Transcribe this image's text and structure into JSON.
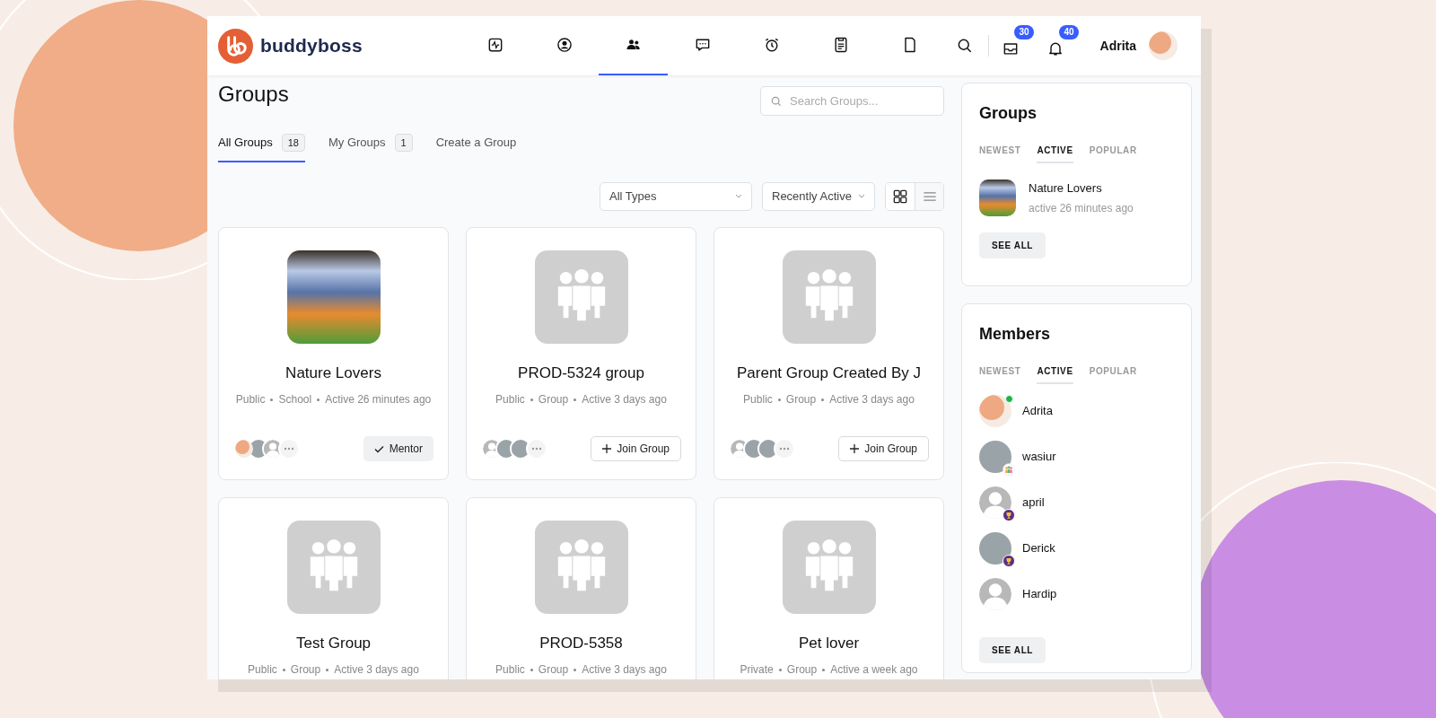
{
  "header": {
    "logo_text": "buddyboss",
    "nav": [
      {
        "kind": "activity",
        "selected": false
      },
      {
        "kind": "profile",
        "selected": false
      },
      {
        "kind": "groups",
        "selected": true
      },
      {
        "kind": "messages",
        "selected": false
      },
      {
        "kind": "alarm",
        "selected": false
      },
      {
        "kind": "document",
        "selected": false
      },
      {
        "kind": "page",
        "selected": false
      }
    ],
    "counters": [
      {
        "kind": "inbox",
        "count": "30"
      },
      {
        "kind": "bell",
        "count": "40"
      }
    ],
    "user": {
      "name": "Adrita"
    }
  },
  "main": {
    "title": "Groups",
    "search": {
      "placeholder": "Search Groups..."
    },
    "tabs": [
      {
        "label": "All Groups",
        "count": "18",
        "selected": true
      },
      {
        "label": "My Groups",
        "count": "1",
        "selected": false
      },
      {
        "label": "Create a Group",
        "selected": false
      }
    ],
    "filters": [
      {
        "value": "All Types"
      },
      {
        "value": "Recently Active"
      }
    ],
    "views": [
      {
        "kind": "grid",
        "selected": true
      },
      {
        "kind": "list",
        "selected": false
      }
    ],
    "cards": [
      {
        "name": "Nature Lovers",
        "image": {
          "kind": "photo"
        },
        "meta": [
          "Public",
          "School",
          "Active 26 minutes ago"
        ],
        "members": [
          {
            "kind": "user"
          },
          {
            "kind": "photo"
          },
          {
            "kind": "silhouette"
          }
        ],
        "button": {
          "kind": "joined",
          "label": "Mentor"
        }
      },
      {
        "name": "PROD-5324 group",
        "image": {
          "kind": "placeholder"
        },
        "meta": [
          "Public",
          "Group",
          "Active 3 days ago"
        ],
        "members": [
          {
            "kind": "silhouette"
          },
          {
            "kind": "photo"
          },
          {
            "kind": "photo"
          }
        ],
        "button": {
          "kind": "join",
          "label": "Join Group"
        }
      },
      {
        "name": "Parent Group Created By J",
        "image": {
          "kind": "placeholder"
        },
        "meta": [
          "Public",
          "Group",
          "Active 3 days ago"
        ],
        "members": [
          {
            "kind": "silhouette"
          },
          {
            "kind": "photo"
          },
          {
            "kind": "photo"
          }
        ],
        "button": {
          "kind": "join",
          "label": "Join Group"
        }
      },
      {
        "name": "Test Group",
        "image": {
          "kind": "placeholder"
        },
        "meta": [
          "Public",
          "Group",
          "Active 3 days ago"
        ]
      },
      {
        "name": "PROD-5358",
        "image": {
          "kind": "placeholder"
        },
        "meta": [
          "Public",
          "Group",
          "Active 3 days ago"
        ]
      },
      {
        "name": "Pet lover",
        "image": {
          "kind": "placeholder"
        },
        "meta": [
          "Private",
          "Group",
          "Active a week ago"
        ]
      }
    ]
  },
  "sidebar": {
    "groups": {
      "title": "Groups",
      "tabs": [
        {
          "label": "NEWEST",
          "selected": false
        },
        {
          "label": "ACTIVE",
          "selected": true
        },
        {
          "label": "POPULAR",
          "selected": false
        }
      ],
      "items": [
        {
          "name": "Nature Lovers",
          "meta": "active 26 minutes ago"
        }
      ],
      "button": "SEE ALL"
    },
    "members": {
      "title": "Members",
      "tabs": [
        {
          "label": "NEWEST",
          "selected": false
        },
        {
          "label": "ACTIVE",
          "selected": true
        },
        {
          "label": "POPULAR",
          "selected": false
        }
      ],
      "items": [
        {
          "name": "Adrita",
          "avatar": {
            "kind": "user"
          },
          "online": true
        },
        {
          "name": "wasiur",
          "avatar": {
            "kind": "photo"
          },
          "online": false,
          "badge": {
            "kind": "people"
          }
        },
        {
          "name": "april",
          "avatar": {
            "kind": "silhouette"
          },
          "online": false,
          "badge": {
            "kind": "trophy"
          }
        },
        {
          "name": "Derick",
          "avatar": {
            "kind": "photo"
          },
          "online": false,
          "badge": {
            "kind": "trophy"
          }
        },
        {
          "name": "Hardip",
          "avatar": {
            "kind": "silhouette"
          },
          "online": false
        }
      ],
      "button": "SEE ALL"
    }
  }
}
